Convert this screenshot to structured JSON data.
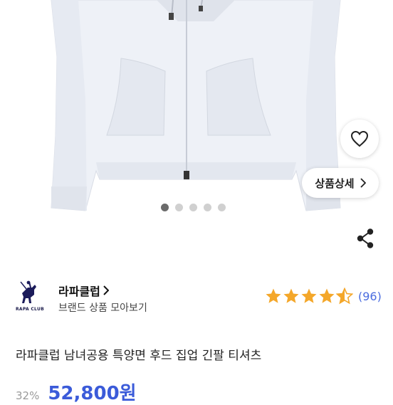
{
  "product_image": {
    "alt": "white zip-up hoodie"
  },
  "wishlist": {
    "icon": "heart-outline-icon"
  },
  "detail_button": {
    "label": "상품상세",
    "icon": "chevron-right-icon"
  },
  "carousel": {
    "total": 5,
    "active_index": 0
  },
  "share": {
    "icon": "share-icon"
  },
  "brand": {
    "logo_text": "RAPA CLUB",
    "name": "라파클럽",
    "name_chevron": "chevron-right-icon",
    "subtitle": "브랜드 상품 모아보기"
  },
  "rating": {
    "stars": 4.5,
    "max": 5,
    "count_text": "(96)",
    "star_color": "#f4a72a"
  },
  "product": {
    "title": "라파클럽 남녀공용 특양면 후드 집업 긴팔 티셔츠",
    "discount": "32%",
    "price": "52,800원",
    "price_color": "#3b5bd9"
  }
}
